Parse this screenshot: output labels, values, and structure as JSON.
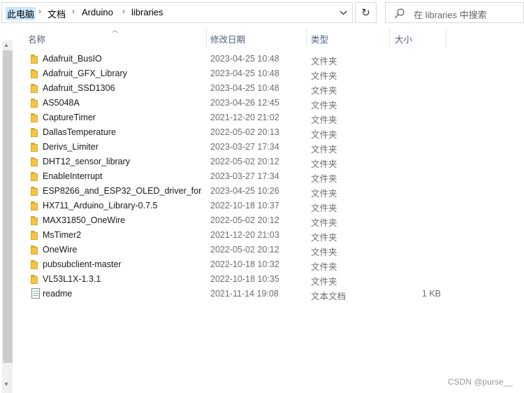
{
  "address_bar": {
    "breadcrumbs": [
      "此电脑",
      "文档",
      "Arduino",
      "libraries"
    ]
  },
  "search": {
    "placeholder": "在 libraries 中搜索"
  },
  "columns": {
    "name": "名称",
    "date": "修改日期",
    "type": "类型",
    "size": "大小"
  },
  "files": [
    {
      "name": "Adafruit_BusIO",
      "date": "2023-04-25 10:48",
      "type": "文件夹",
      "size": "",
      "icon": "folder-icon"
    },
    {
      "name": "Adafruit_GFX_Library",
      "date": "2023-04-25 10:48",
      "type": "文件夹",
      "size": "",
      "icon": "folder-icon"
    },
    {
      "name": "Adafruit_SSD1306",
      "date": "2023-04-25 10:48",
      "type": "文件夹",
      "size": "",
      "icon": "folder-icon"
    },
    {
      "name": "AS5048A",
      "date": "2023-04-26 12:45",
      "type": "文件夹",
      "size": "",
      "icon": "folder-icon"
    },
    {
      "name": "CaptureTimer",
      "date": "2021-12-20 21:02",
      "type": "文件夹",
      "size": "",
      "icon": "folder-icon"
    },
    {
      "name": "DallasTemperature",
      "date": "2022-05-02 20:13",
      "type": "文件夹",
      "size": "",
      "icon": "folder-icon"
    },
    {
      "name": "Derivs_Limiter",
      "date": "2023-03-27 17:34",
      "type": "文件夹",
      "size": "",
      "icon": "folder-icon"
    },
    {
      "name": "DHT12_sensor_library",
      "date": "2022-05-02 20:12",
      "type": "文件夹",
      "size": "",
      "icon": "folder-icon"
    },
    {
      "name": "EnableInterrupt",
      "date": "2023-03-27 17:34",
      "type": "文件夹",
      "size": "",
      "icon": "folder-icon"
    },
    {
      "name": "ESP8266_and_ESP32_OLED_driver_for...",
      "date": "2023-04-25 10:26",
      "type": "文件夹",
      "size": "",
      "icon": "folder-icon"
    },
    {
      "name": "HX711_Arduino_Library-0.7.5",
      "date": "2022-10-18 10:37",
      "type": "文件夹",
      "size": "",
      "icon": "folder-icon"
    },
    {
      "name": "MAX31850_OneWire",
      "date": "2022-05-02 20:12",
      "type": "文件夹",
      "size": "",
      "icon": "folder-icon"
    },
    {
      "name": "MsTimer2",
      "date": "2021-12-20 21:03",
      "type": "文件夹",
      "size": "",
      "icon": "folder-icon"
    },
    {
      "name": "OneWire",
      "date": "2022-05-02 20:12",
      "type": "文件夹",
      "size": "",
      "icon": "folder-icon"
    },
    {
      "name": "pubsubclient-master",
      "date": "2022-10-18 10:32",
      "type": "文件夹",
      "size": "",
      "icon": "folder-icon"
    },
    {
      "name": "VL53L1X-1.3.1",
      "date": "2022-10-18 10:35",
      "type": "文件夹",
      "size": "",
      "icon": "folder-icon"
    },
    {
      "name": "readme",
      "date": "2021-11-14 19:08",
      "type": "文本文档",
      "size": "1 KB",
      "icon": "text-file-icon"
    }
  ],
  "watermark": "CSDN @purse__"
}
